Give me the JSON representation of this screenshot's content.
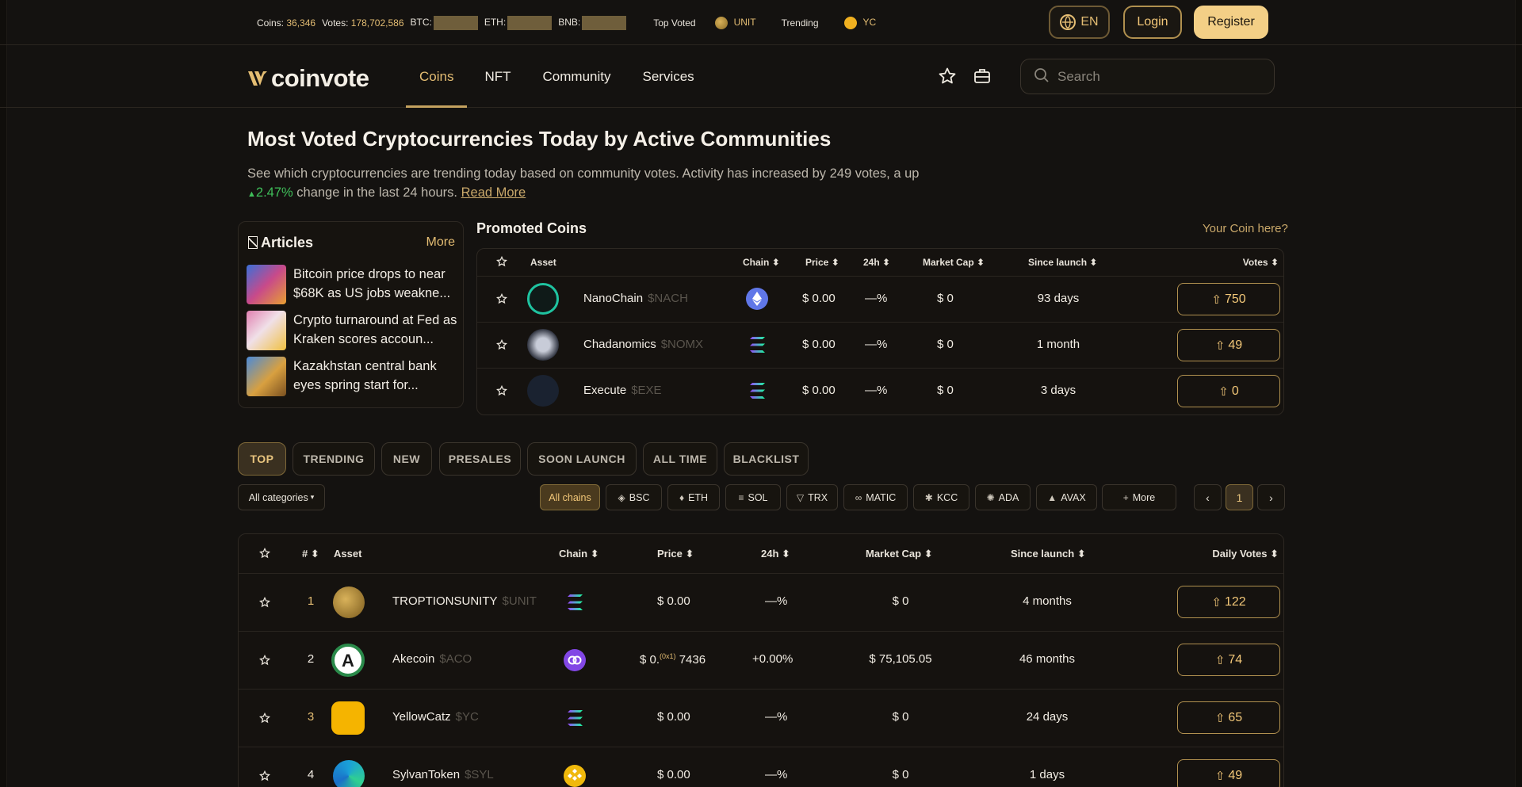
{
  "ticker": {
    "coins_label": "Coins:",
    "coins_value": "36,346",
    "votes_label": "Votes:",
    "votes_value": "178,702,586",
    "btc_label": "BTC:",
    "eth_label": "ETH:",
    "bnb_label": "BNB:",
    "top_voted": "Top Voted",
    "top_voted_coin": "UNIT",
    "trending": "Trending",
    "trending_coin": "YC"
  },
  "header": {
    "lang": "EN",
    "login": "Login",
    "register": "Register"
  },
  "nav": {
    "logo": "coinvote",
    "items": [
      "Coins",
      "NFT",
      "Community",
      "Services"
    ],
    "active": "Coins",
    "search_placeholder": "Search"
  },
  "hero": {
    "title": "Most Voted Cryptocurrencies Today by Active Communities",
    "text1": "See which cryptocurrencies are trending today based on community votes. Activity has increased by 249 votes, a up",
    "change": "2.47%",
    "text2": "change in the last 24 hours.",
    "read_more": "Read More"
  },
  "articles": {
    "title": "Articles",
    "more": "More",
    "items": [
      {
        "title": "Bitcoin price drops to near $68K as US jobs weakne..."
      },
      {
        "title": "Crypto turnaround at Fed as Kraken scores accoun..."
      },
      {
        "title": "Kazakhstan central bank eyes spring start for..."
      }
    ]
  },
  "promoted": {
    "title": "Promoted Coins",
    "cta": "Your Coin here?",
    "headers": {
      "asset": "Asset",
      "chain": "Chain",
      "price": "Price",
      "change": "24h",
      "mcap": "Market Cap",
      "since": "Since launch",
      "votes": "Votes"
    },
    "rows": [
      {
        "name": "NanoChain",
        "ticker": "$NACH",
        "price": "$ 0.00",
        "change": "—%",
        "mcap": "$ 0",
        "since": "93 days",
        "votes": "750"
      },
      {
        "name": "Chadanomics",
        "ticker": "$NOMX",
        "price": "$ 0.00",
        "change": "—%",
        "mcap": "$ 0",
        "since": "1 month",
        "votes": "49"
      },
      {
        "name": "Execute",
        "ticker": "$EXE",
        "price": "$ 0.00",
        "change": "—%",
        "mcap": "$ 0",
        "since": "3 days",
        "votes": "0"
      }
    ]
  },
  "tabs": [
    "TOP",
    "TRENDING",
    "NEW",
    "PRESALES",
    "SOON LAUNCH",
    "ALL TIME",
    "BLACKLIST"
  ],
  "filters": {
    "category": "All categories",
    "chains": [
      "All chains",
      "BSC",
      "ETH",
      "SOL",
      "TRX",
      "MATIC",
      "KCC",
      "ADA",
      "AVAX",
      "More"
    ],
    "page": "1"
  },
  "table": {
    "headers": {
      "rank": "#",
      "asset": "Asset",
      "chain": "Chain",
      "price": "Price",
      "change": "24h",
      "mcap": "Market Cap",
      "since": "Since launch",
      "votes": "Daily Votes"
    },
    "rows": [
      {
        "rank": "1",
        "name": "TROPTIONSUNITY",
        "ticker": "$UNIT",
        "price": "$ 0.00",
        "change": "—%",
        "mcap": "$ 0",
        "since": "4 months",
        "votes": "122"
      },
      {
        "rank": "2",
        "name": "Akecoin",
        "ticker": "$ACO",
        "price_a": "$ 0.",
        "price_sub": "(0x1)",
        "price_b": "7436",
        "change": "+0.00%",
        "mcap": "$ 75,105.05",
        "since": "46 months",
        "votes": "74"
      },
      {
        "rank": "3",
        "name": "YellowCatz",
        "ticker": "$YC",
        "price": "$ 0.00",
        "change": "—%",
        "mcap": "$ 0",
        "since": "24 days",
        "votes": "65"
      },
      {
        "rank": "4",
        "name": "SylvanToken",
        "ticker": "$SYL",
        "price": "$ 0.00",
        "change": "—%",
        "mcap": "$ 0",
        "since": "1 days",
        "votes": "49"
      }
    ]
  },
  "colors": {
    "accent": "#e4bd73",
    "background": "#141210",
    "positive": "#3fbf5a"
  }
}
